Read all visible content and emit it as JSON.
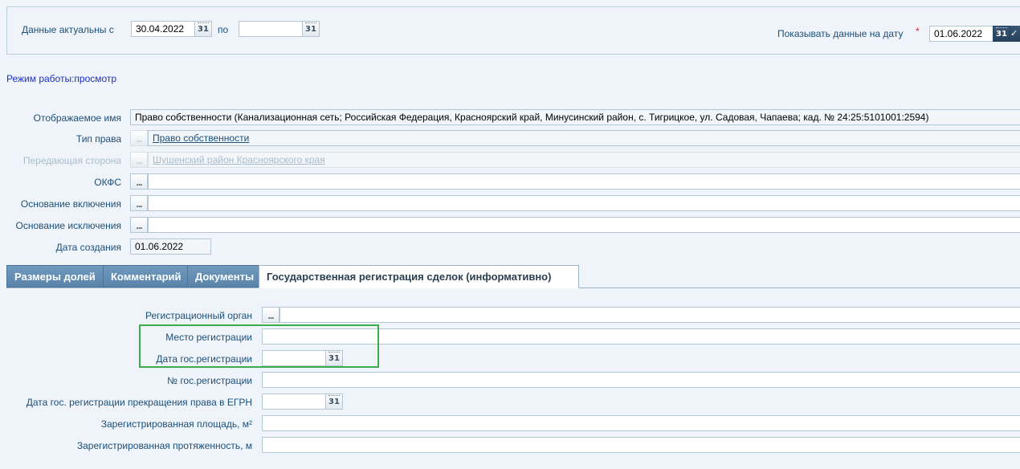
{
  "filter": {
    "actual_from_label": "Данные актуальны с",
    "actual_from_value": "30.04.2022",
    "to_label": "по",
    "to_value": "",
    "show_on_date_label": "Показывать данные на дату",
    "required_mark": "*",
    "show_on_date_value": "01.06.2022",
    "calendar_glyph": "31"
  },
  "mode_text": "Режим работы:просмотр",
  "fields": {
    "display_name_label": "Отображаемое имя",
    "display_name_value": "Право собственности (Канализационная сеть; Российская Федерация, Красноярский край, Минусинский район, с. Тигрицкое, ул. Садовая, Чапаева; кад. № 24:25:5101001:2594)",
    "right_type_label": "Тип права",
    "right_type_value": "Право собственности",
    "transferring_party_label": "Передающая сторона",
    "transferring_party_value": "Шушенский район Красноярского края",
    "okfs_label": "ОКФС",
    "okfs_value": "",
    "inclusion_basis_label": "Основание включения",
    "inclusion_basis_value": "",
    "exclusion_basis_label": "Основание исключения",
    "exclusion_basis_value": "",
    "creation_date_label": "Дата создания",
    "creation_date_value": "01.06.2022",
    "picker_glyph": "..."
  },
  "tabs": [
    {
      "label": "Размеры долей"
    },
    {
      "label": "Комментарий"
    },
    {
      "label": "Документы"
    },
    {
      "label": "Государственная регистрация сделок (информативно)"
    }
  ],
  "registration": {
    "reg_body_label": "Регистрационный орган",
    "reg_place_label": "Место регистрации",
    "reg_date_label": "Дата гос.регистрации",
    "reg_number_label": "№ гос.регистрации",
    "termination_date_label": "Дата гос. регистрации прекращения права в ЕГРН",
    "area_label": "Зарегистрированная площадь, м²",
    "length_label": "Зарегистрированная протяженность, м"
  },
  "colors": {
    "highlight": "#3aac4a",
    "panel_bg": "#eef4f9",
    "tab_bg": "#5f8aaf"
  }
}
